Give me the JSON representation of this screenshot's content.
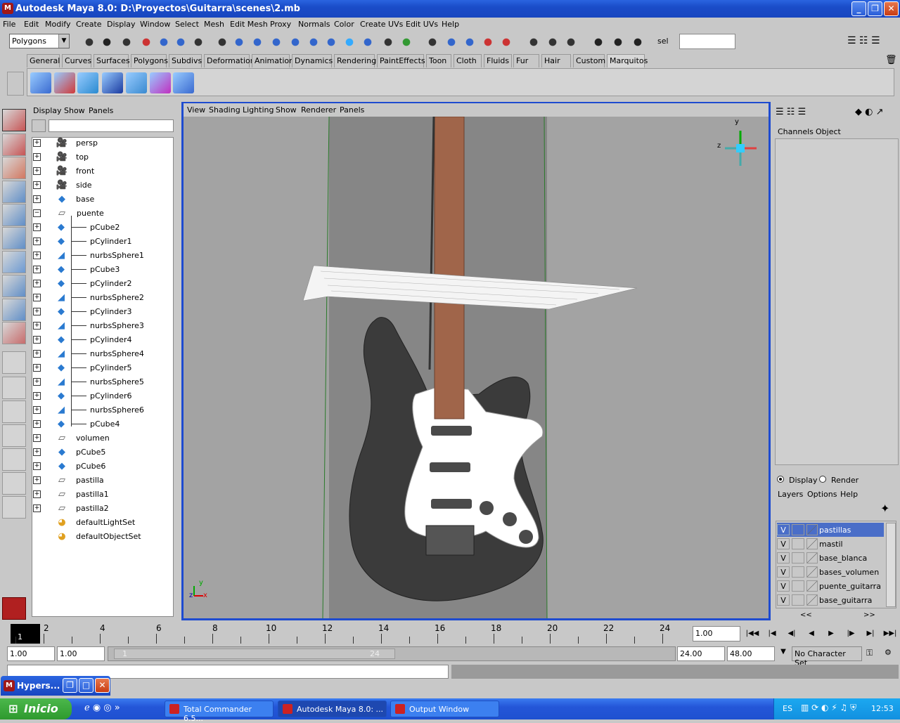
{
  "window": {
    "title": "Autodesk Maya 8.0: D:\\Proyectos\\Guitarra\\scenes\\2.mb"
  },
  "menubar": [
    "File",
    "Edit",
    "Modify",
    "Create",
    "Display",
    "Window",
    "Select",
    "Mesh",
    "Edit Mesh",
    "Proxy",
    "Normals",
    "Color",
    "Create UVs",
    "Edit UVs",
    "Help"
  ],
  "toolbar": {
    "mode": "Polygons",
    "sel_label": "sel"
  },
  "shelf_tabs": [
    "General",
    "Curves",
    "Surfaces",
    "Polygons",
    "Subdivs",
    "Deformation",
    "Animation",
    "Dynamics",
    "Rendering",
    "PaintEffects",
    "Toon",
    "Cloth",
    "Fluids",
    "Fur",
    "Hair",
    "Custom",
    "Marquitos"
  ],
  "shelf_active": "Marquitos",
  "outliner": {
    "menu": [
      "Display",
      "Show",
      "Panels"
    ],
    "items": [
      {
        "label": "persp",
        "icon": "camera-icon",
        "indent": 0
      },
      {
        "label": "top",
        "icon": "camera-icon",
        "indent": 0
      },
      {
        "label": "front",
        "icon": "camera-icon",
        "indent": 0
      },
      {
        "label": "side",
        "icon": "camera-icon",
        "indent": 0
      },
      {
        "label": "base",
        "icon": "mesh-icon",
        "indent": 0
      },
      {
        "label": "puente",
        "icon": "group-icon",
        "indent": 0,
        "expanded": true
      },
      {
        "label": "pCube2",
        "icon": "mesh-icon",
        "indent": 1
      },
      {
        "label": "pCylinder1",
        "icon": "mesh-icon",
        "indent": 1
      },
      {
        "label": "nurbsSphere1",
        "icon": "nurbs-icon",
        "indent": 1
      },
      {
        "label": "pCube3",
        "icon": "mesh-icon",
        "indent": 1
      },
      {
        "label": "pCylinder2",
        "icon": "mesh-icon",
        "indent": 1
      },
      {
        "label": "nurbsSphere2",
        "icon": "nurbs-icon",
        "indent": 1
      },
      {
        "label": "pCylinder3",
        "icon": "mesh-icon",
        "indent": 1
      },
      {
        "label": "nurbsSphere3",
        "icon": "nurbs-icon",
        "indent": 1
      },
      {
        "label": "pCylinder4",
        "icon": "mesh-icon",
        "indent": 1
      },
      {
        "label": "nurbsSphere4",
        "icon": "nurbs-icon",
        "indent": 1
      },
      {
        "label": "pCylinder5",
        "icon": "mesh-icon",
        "indent": 1
      },
      {
        "label": "nurbsSphere5",
        "icon": "nurbs-icon",
        "indent": 1
      },
      {
        "label": "pCylinder6",
        "icon": "mesh-icon",
        "indent": 1
      },
      {
        "label": "nurbsSphere6",
        "icon": "nurbs-icon",
        "indent": 1
      },
      {
        "label": "pCube4",
        "icon": "mesh-icon",
        "indent": 1
      },
      {
        "label": "volumen",
        "icon": "group-icon",
        "indent": 0
      },
      {
        "label": "pCube5",
        "icon": "mesh-icon",
        "indent": 0
      },
      {
        "label": "pCube6",
        "icon": "mesh-icon",
        "indent": 0
      },
      {
        "label": "pastilla",
        "icon": "group-icon",
        "indent": 0
      },
      {
        "label": "pastilla1",
        "icon": "group-icon",
        "indent": 0
      },
      {
        "label": "pastilla2",
        "icon": "group-icon",
        "indent": 0
      },
      {
        "label": "defaultLightSet",
        "icon": "set-icon",
        "indent": 0,
        "noplus": true
      },
      {
        "label": "defaultObjectSet",
        "icon": "set-icon",
        "indent": 0,
        "noplus": true
      }
    ]
  },
  "viewport": {
    "menu": [
      "View",
      "Shading",
      "Lighting",
      "Show",
      "Renderer",
      "Panels"
    ],
    "axis": {
      "x": "x",
      "y": "y",
      "z": "z"
    }
  },
  "channelbox": {
    "menu": [
      "Channels",
      "Object"
    ]
  },
  "layers": {
    "display_label": "Display",
    "render_label": "Render",
    "menu": [
      "Layers",
      "Options",
      "Help"
    ],
    "rows": [
      {
        "v": "V",
        "name": "pastillas",
        "selected": true
      },
      {
        "v": "V",
        "name": "mastil"
      },
      {
        "v": "V",
        "name": "base_blanca"
      },
      {
        "v": "V",
        "name": "bases_volumen"
      },
      {
        "v": "V",
        "name": "puente_guitarra"
      },
      {
        "v": "V",
        "name": "base_guitarra"
      }
    ],
    "scroll_left": "<<",
    "scroll_right": ">>"
  },
  "timeline": {
    "ticks": [
      "2",
      "4",
      "6",
      "8",
      "10",
      "12",
      "14",
      "16",
      "18",
      "20",
      "22",
      "24"
    ],
    "current": "1",
    "current_field": "1.00"
  },
  "range": {
    "start": "1.00",
    "inner_start": "1.00",
    "slider_start": "1",
    "slider_end": "24",
    "end": "24.00",
    "outer_end": "48.00",
    "charset": "No Character Set"
  },
  "hypershade": {
    "title": "Hypers..."
  },
  "taskbar": {
    "start": "Inicio",
    "tasks": [
      "Total Commander 6.5...",
      "Autodesk Maya 8.0: ...",
      "Output Window"
    ],
    "lang": "ES",
    "clock": "12:53"
  },
  "colors": {
    "titlebar": "#1f55d4",
    "viewport_bg": "#a3a3a3",
    "guitar_body": "#3c3c3c",
    "neck": "#a0654a",
    "pickguard": "#ffffff",
    "layer_selected": "#4a6ec8"
  }
}
